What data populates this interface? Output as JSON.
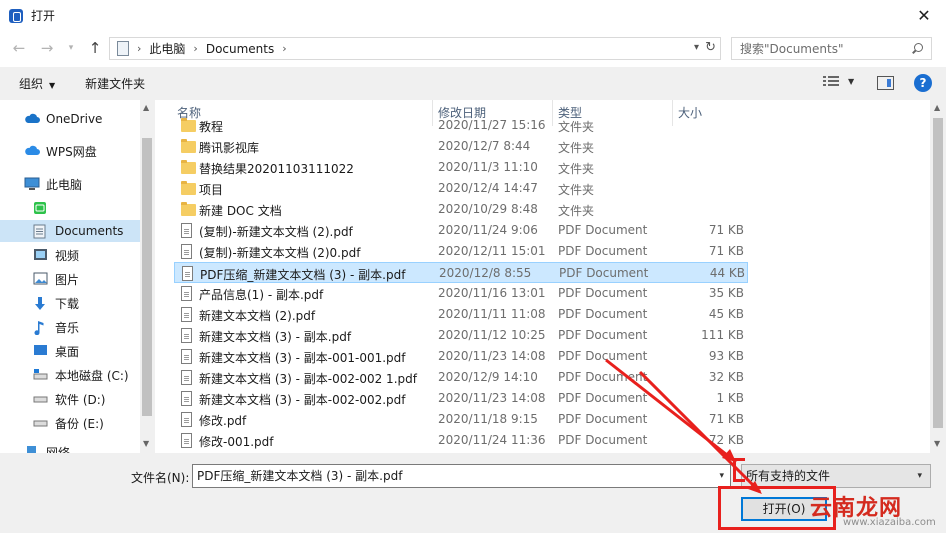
{
  "window": {
    "title": "打开",
    "close": "✕"
  },
  "address": {
    "path": [
      "此电脑",
      "Documents"
    ]
  },
  "search": {
    "placeholder": "搜索\"Documents\""
  },
  "toolbar": {
    "organize": "组织",
    "new_folder": "新建文件夹",
    "help": "?"
  },
  "sidebar": {
    "items": [
      {
        "label": "OneDrive",
        "icon": "cloud-icon"
      },
      {
        "label": "WPS网盘",
        "icon": "wps-cloud-icon"
      },
      {
        "label": "此电脑",
        "icon": "computer-icon"
      },
      {
        "label": "",
        "icon": "wechat-folder-icon"
      },
      {
        "label": "Documents",
        "icon": "documents-icon",
        "selected": true
      },
      {
        "label": "视频",
        "icon": "video-icon"
      },
      {
        "label": "图片",
        "icon": "picture-icon"
      },
      {
        "label": "下载",
        "icon": "download-icon"
      },
      {
        "label": "音乐",
        "icon": "music-icon"
      },
      {
        "label": "桌面",
        "icon": "desktop-icon"
      },
      {
        "label": "本地磁盘 (C:)",
        "icon": "drive-c-icon"
      },
      {
        "label": "软件 (D:)",
        "icon": "drive-icon"
      },
      {
        "label": "备份 (E:)",
        "icon": "drive-icon"
      },
      {
        "label": "网络",
        "icon": "network-icon"
      }
    ]
  },
  "columns": {
    "name": "名称",
    "date": "修改日期",
    "type": "类型",
    "size": "大小"
  },
  "files": [
    {
      "name": "教程",
      "date": "2020/11/27 15:16",
      "type": "文件夹",
      "size": "",
      "kind": "folder"
    },
    {
      "name": "腾讯影视库",
      "date": "2020/12/7 8:44",
      "type": "文件夹",
      "size": "",
      "kind": "folder"
    },
    {
      "name": "替换结果20201103111022",
      "date": "2020/11/3 11:10",
      "type": "文件夹",
      "size": "",
      "kind": "folder"
    },
    {
      "name": "项目",
      "date": "2020/12/4 14:47",
      "type": "文件夹",
      "size": "",
      "kind": "folder"
    },
    {
      "name": "新建 DOC 文档",
      "date": "2020/10/29 8:48",
      "type": "文件夹",
      "size": "",
      "kind": "folder"
    },
    {
      "name": "(复制)-新建文本文档 (2).pdf",
      "date": "2020/11/24 9:06",
      "type": "PDF Document",
      "size": "71 KB",
      "kind": "pdf"
    },
    {
      "name": "(复制)-新建文本文档 (2)0.pdf",
      "date": "2020/12/11 15:01",
      "type": "PDF Document",
      "size": "71 KB",
      "kind": "pdf"
    },
    {
      "name": "PDF压缩_新建文本文档 (3) - 副本.pdf",
      "date": "2020/12/8 8:55",
      "type": "PDF Document",
      "size": "44 KB",
      "kind": "pdf",
      "selected": true
    },
    {
      "name": "产品信息(1) - 副本.pdf",
      "date": "2020/11/16 13:01",
      "type": "PDF Document",
      "size": "35 KB",
      "kind": "pdf"
    },
    {
      "name": "新建文本文档 (2).pdf",
      "date": "2020/11/11 11:08",
      "type": "PDF Document",
      "size": "45 KB",
      "kind": "pdf"
    },
    {
      "name": "新建文本文档 (3) - 副本.pdf",
      "date": "2020/11/12 10:25",
      "type": "PDF Document",
      "size": "111 KB",
      "kind": "pdf"
    },
    {
      "name": "新建文本文档 (3) - 副本-001-001.pdf",
      "date": "2020/11/23 14:08",
      "type": "PDF Document",
      "size": "93 KB",
      "kind": "pdf"
    },
    {
      "name": "新建文本文档 (3) - 副本-002-002 1.pdf",
      "date": "2020/12/9 14:10",
      "type": "PDF Document",
      "size": "32 KB",
      "kind": "pdf"
    },
    {
      "name": "新建文本文档 (3) - 副本-002-002.pdf",
      "date": "2020/11/23 14:08",
      "type": "PDF Document",
      "size": "1 KB",
      "kind": "pdf"
    },
    {
      "name": "修改.pdf",
      "date": "2020/11/18 9:15",
      "type": "PDF Document",
      "size": "71 KB",
      "kind": "pdf"
    },
    {
      "name": "修改-001.pdf",
      "date": "2020/11/24 11:36",
      "type": "PDF Document",
      "size": "72 KB",
      "kind": "pdf"
    }
  ],
  "bottom": {
    "filename_label": "文件名(N):",
    "filename_value": "PDF压缩_新建文本文档 (3) - 副本.pdf",
    "filetype": "所有支持的文件",
    "open_button": "打开(O)"
  },
  "watermark": {
    "text": "云南龙网",
    "sub": "www.xiazaiba.com"
  },
  "colors": {
    "accent": "#0078d7",
    "selection": "#cce8ff",
    "annotation": "#e8201d"
  }
}
